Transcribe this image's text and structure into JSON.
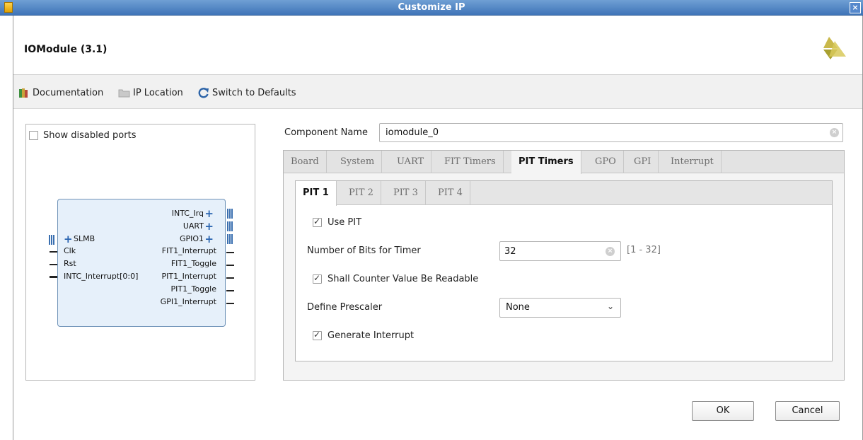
{
  "window": {
    "title": "Customize IP",
    "close_glyph": "×"
  },
  "header": {
    "ip_title": "IOModule (3.1)"
  },
  "toolbar": {
    "documentation": "Documentation",
    "ip_location": "IP Location",
    "switch_defaults": "Switch to Defaults"
  },
  "left_panel": {
    "show_disabled_ports": "Show disabled ports",
    "show_disabled_checked": false,
    "left_ports": [
      "SLMB",
      "Clk",
      "Rst",
      "INTC_Interrupt[0:0]"
    ],
    "right_ports": [
      "INTC_Irq",
      "UART",
      "GPIO1",
      "FIT1_Interrupt",
      "FIT1_Toggle",
      "PIT1_Interrupt",
      "PIT1_Toggle",
      "GPI1_Interrupt"
    ]
  },
  "component": {
    "label": "Component Name",
    "value": "iomodule_0"
  },
  "tabs": [
    "Board",
    "System",
    "UART",
    "FIT Timers",
    "PIT Timers",
    "GPO",
    "GPI",
    "Interrupt"
  ],
  "active_tab": "PIT Timers",
  "subtabs": [
    "PIT 1",
    "PIT 2",
    "PIT 3",
    "PIT 4"
  ],
  "active_subtab": "PIT 1",
  "pit": {
    "use_pit": "Use PIT",
    "use_pit_checked": true,
    "bits_label": "Number of Bits for Timer",
    "bits_value": "32",
    "bits_range": "[1 - 32]",
    "readable": "Shall Counter Value Be Readable",
    "readable_checked": true,
    "prescaler_label": "Define Prescaler",
    "prescaler_value": "None",
    "interrupt": "Generate Interrupt",
    "interrupt_checked": true
  },
  "buttons": {
    "ok": "OK",
    "cancel": "Cancel"
  },
  "colors": {
    "titlebar": "#4a7fc1",
    "block_fill": "#e6f0fa",
    "block_border": "#6f93b8"
  }
}
